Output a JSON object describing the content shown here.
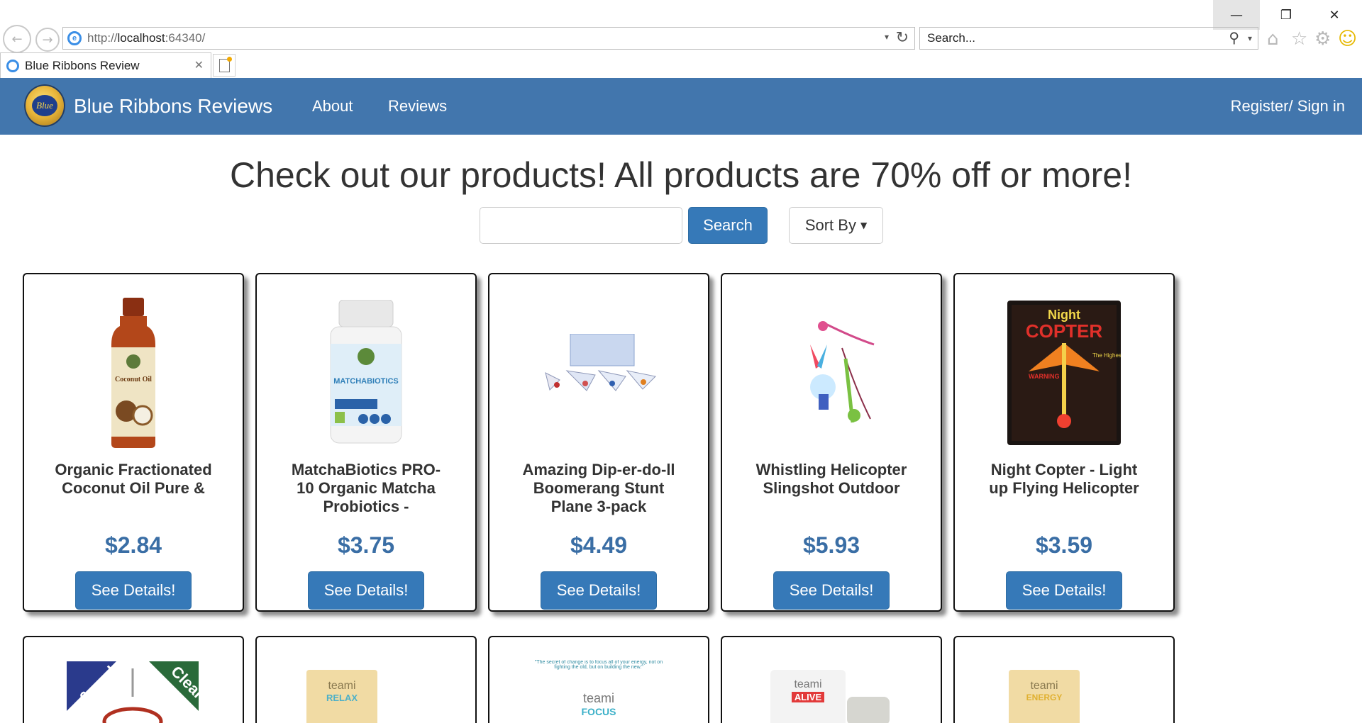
{
  "browser": {
    "back_icon": "back-arrow-icon",
    "forward_icon": "forward-arrow-icon",
    "address_protocol": "http://",
    "address_host": "localhost",
    "address_port": ":64340/",
    "search_placeholder": "Search...",
    "tab_title": "Blue Ribbons Review",
    "window_controls": {
      "minimize": "—",
      "restore": "❐",
      "close": "✕"
    }
  },
  "navbar": {
    "brand": "Blue Ribbons Reviews",
    "logo_text": "Blue",
    "links": {
      "about": "About",
      "reviews": "Reviews"
    },
    "register": "Register/ Sign in",
    "color": "#4276ad"
  },
  "main": {
    "headline": "Check out our products! All products are 70% off or more!",
    "search_button": "Search",
    "sort_label": "Sort By",
    "accent": "#3679b8",
    "price_color": "#3a6ea5"
  },
  "products": [
    {
      "title": "Organic Fractionated Coconut Oil Pure &",
      "price": "$2.84",
      "button": "See Details!",
      "image": "coconut-oil-bottle"
    },
    {
      "title": "MatchaBiotics PRO-10 Organic Matcha Probiotics -",
      "price": "$3.75",
      "button": "See Details!",
      "image": "probiotic-bottle"
    },
    {
      "title": "Amazing Dip-er-do-ll Boomerang Stunt Plane 3-pack",
      "price": "$4.49",
      "button": "See Details!",
      "image": "boomerang-planes"
    },
    {
      "title": "Whistling Helicopter Slingshot Outdoor",
      "price": "$5.93",
      "button": "See Details!",
      "image": "slingshot-helicopter"
    },
    {
      "title": "Night Copter - Light up Flying Helicopter",
      "price": "$3.59",
      "button": "See Details!",
      "image": "night-copter-package"
    }
  ],
  "products_row2": [
    {
      "image": "hooks-6-pack",
      "badges": [
        "6 pack",
        "Clear"
      ]
    },
    {
      "image": "tea-pouch-relax",
      "label": "teami",
      "sub": "RELAX"
    },
    {
      "image": "tea-focus-box",
      "label": "teami",
      "sub": "FOCUS",
      "quote": "\"The secret of change is to focus all of your energy, not on fighting the old, but on building the new.\""
    },
    {
      "image": "tea-alive-pouch",
      "label": "teami",
      "sub": "ALIVE"
    },
    {
      "image": "tea-pouch-energy",
      "label": "teami",
      "sub": "ENERGY"
    }
  ]
}
